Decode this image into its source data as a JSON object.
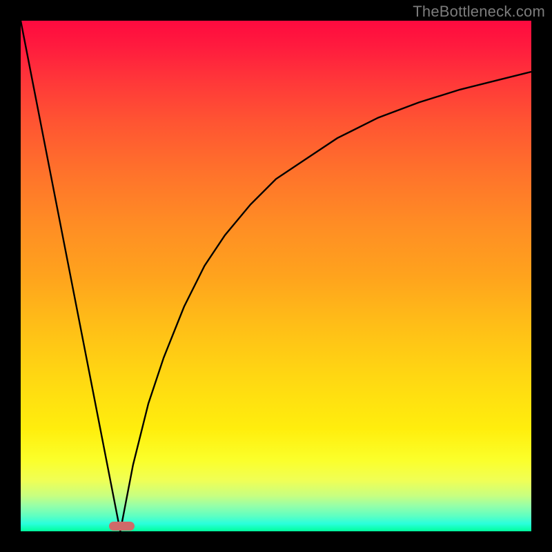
{
  "watermark": "TheBottleneck.com",
  "marker": {
    "left_pct": 17.3,
    "bottom_pct": 0.1,
    "width_pct": 5.0,
    "height_pct": 1.8,
    "color": "#cf6a69"
  },
  "chart_data": {
    "type": "line",
    "title": "",
    "xlabel": "",
    "ylabel": "",
    "xlim": [
      0,
      100
    ],
    "ylim": [
      0,
      100
    ],
    "grid": false,
    "legend": false,
    "series": [
      {
        "name": "left-linear-segment",
        "x": [
          0,
          19.5
        ],
        "y": [
          100,
          0
        ]
      },
      {
        "name": "right-curve-segment",
        "x": [
          19.5,
          22,
          25,
          28,
          32,
          36,
          40,
          45,
          50,
          56,
          62,
          70,
          78,
          86,
          94,
          100
        ],
        "y": [
          0,
          13,
          25,
          34,
          44,
          52,
          58,
          64,
          69,
          73,
          77,
          81,
          84,
          86.5,
          88.5,
          90
        ]
      }
    ],
    "annotations": []
  }
}
